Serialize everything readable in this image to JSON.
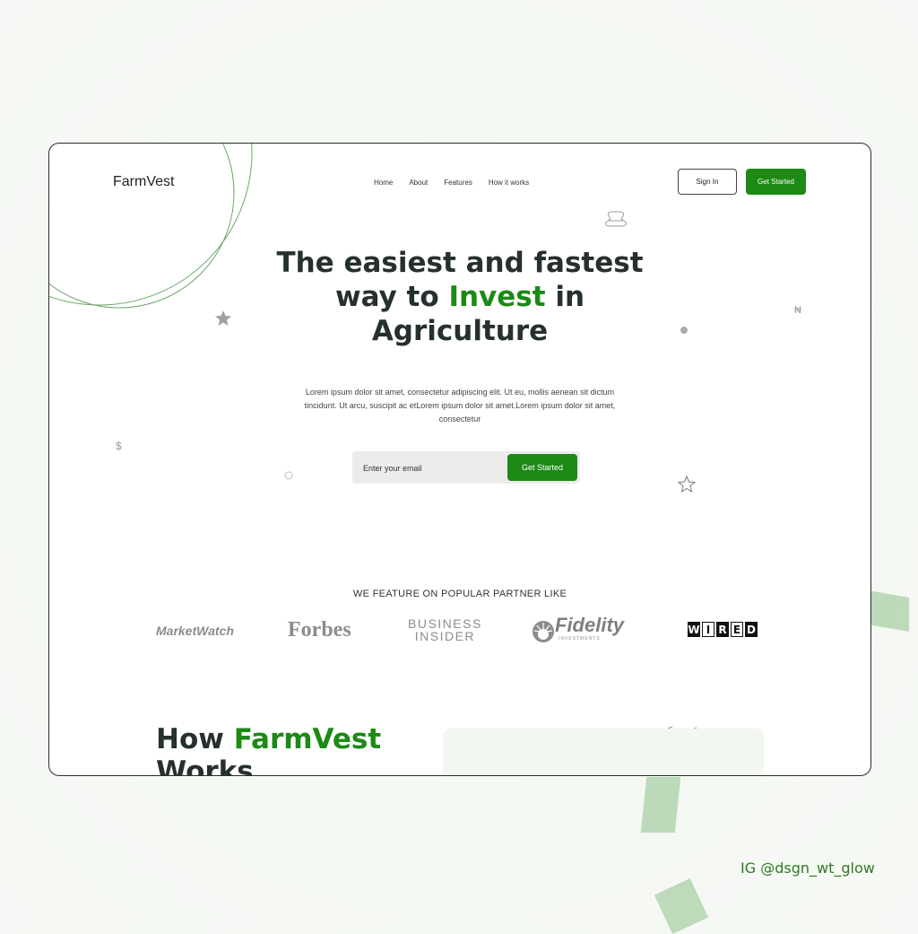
{
  "brand": {
    "name": "FarmVest",
    "accent_color": "#1c8a14",
    "text_color": "#26302d"
  },
  "nav": {
    "items": [
      "Home",
      "About",
      "Features",
      "How it works"
    ]
  },
  "auth": {
    "sign_in_label": "Sign In",
    "get_started_label": "Get Started"
  },
  "hero": {
    "line1": "The easiest and fastest",
    "line2_pre": "way to ",
    "line2_accent": "Invest",
    "line2_post": " in",
    "line3": "Agriculture",
    "lead": "Lorem ipsum dolor sit amet, consectetur adipiscing elit. Ut eu, mollis aenean sit dictum tincidunt. Ut arcu, suscipit ac etLorem ipsum dolor sit amet.Lorem ipsum dolor sit amet, consectetur"
  },
  "signup": {
    "email_placeholder": "Enter your email",
    "button_label": "Get Started"
  },
  "decor_symbols": {
    "dollar": "$",
    "naira": "₦"
  },
  "partners": {
    "title": "WE FEATURE ON POPULAR PARTNER LIKE",
    "marketwatch": "MarketWatch",
    "forbes": "Forbes",
    "business_insider": [
      "BUSINESS",
      "INSIDER"
    ],
    "fidelity": "Fidelity",
    "fidelity_sub": "INVESTMENTS",
    "wired": [
      "W",
      "I",
      "R",
      "E",
      "D"
    ]
  },
  "how_it_works": {
    "title_pre": "How ",
    "title_accent": "FarmVest",
    "title_line2": "Works"
  },
  "credit": "IG @dsgn_wt_glow"
}
